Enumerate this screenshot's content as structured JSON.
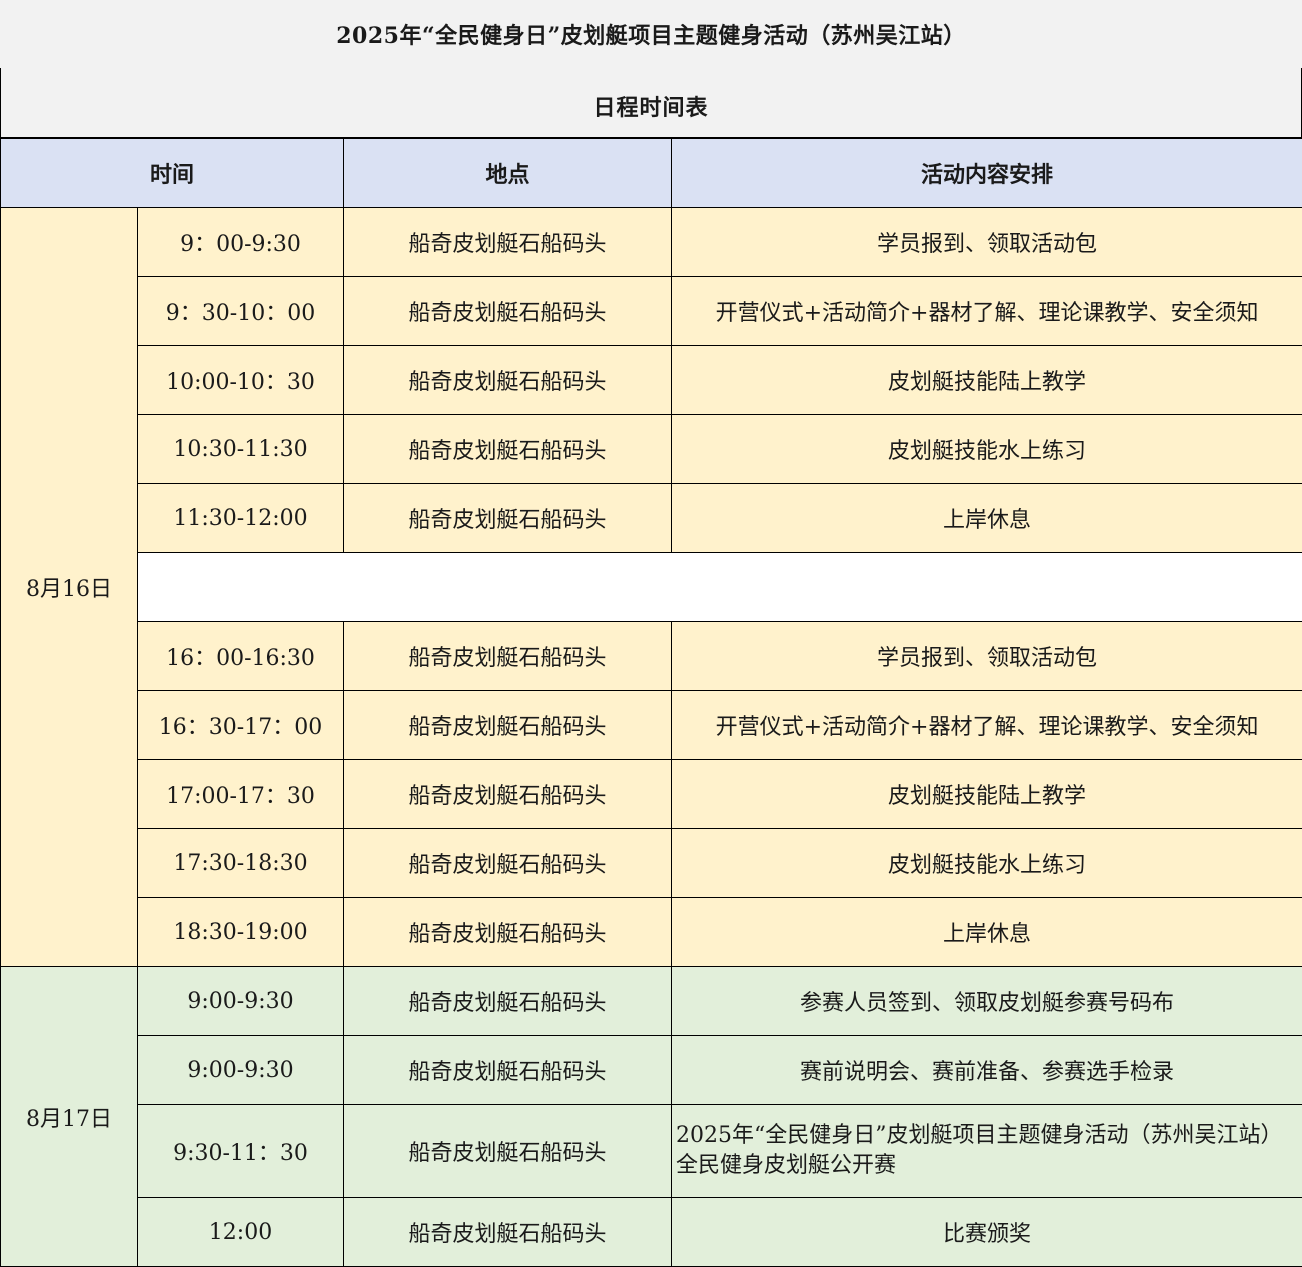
{
  "header": {
    "title": "2025年“全民健身日”皮划艇项目主题健身活动（苏州吴江站）",
    "subtitle": "日程时间表"
  },
  "table": {
    "columns": [
      "时间",
      "地点",
      "活动内容安排"
    ],
    "day1": {
      "date": "8月16日",
      "morning": [
        {
          "time": "9：00-9:30",
          "location": "船奇皮划艇石船码头",
          "activity": "学员报到、领取活动包"
        },
        {
          "time": "9：30-10：00",
          "location": "船奇皮划艇石船码头",
          "activity": "开营仪式+活动简介+器材了解、理论课教学、安全须知"
        },
        {
          "time": "10:00-10：30",
          "location": "船奇皮划艇石船码头",
          "activity": "皮划艇技能陆上教学"
        },
        {
          "time": "10:30-11:30",
          "location": "船奇皮划艇石船码头",
          "activity": "皮划艇技能水上练习"
        },
        {
          "time": "11:30-12:00",
          "location": "船奇皮划艇石船码头",
          "activity": "上岸休息"
        }
      ],
      "afternoon": [
        {
          "time": "16：00-16:30",
          "location": "船奇皮划艇石船码头",
          "activity": "学员报到、领取活动包"
        },
        {
          "time": "16：30-17：00",
          "location": "船奇皮划艇石船码头",
          "activity": "开营仪式+活动简介+器材了解、理论课教学、安全须知"
        },
        {
          "time": "17:00-17：30",
          "location": "船奇皮划艇石船码头",
          "activity": "皮划艇技能陆上教学"
        },
        {
          "time": "17:30-18:30",
          "location": "船奇皮划艇石船码头",
          "activity": "皮划艇技能水上练习"
        },
        {
          "time": "18:30-19:00",
          "location": "船奇皮划艇石船码头",
          "activity": "上岸休息"
        }
      ]
    },
    "day2": {
      "date": "8月17日",
      "rows": [
        {
          "time": "9:00-9:30",
          "location": "船奇皮划艇石船码头",
          "activity": "参赛人员签到、领取皮划艇参赛号码布"
        },
        {
          "time": "9:00-9:30",
          "location": "船奇皮划艇石船码头",
          "activity": "赛前说明会、赛前准备、参赛选手检录"
        },
        {
          "time": "9:30-11：30",
          "location": "船奇皮划艇石船码头",
          "activity": "2025年“全民健身日”皮划艇项目主题健身活动（苏州吴江站）全民健身皮划艇公开赛"
        },
        {
          "time": "12:00",
          "location": "船奇皮划艇石船码头",
          "activity": "比赛颁奖"
        }
      ]
    }
  }
}
